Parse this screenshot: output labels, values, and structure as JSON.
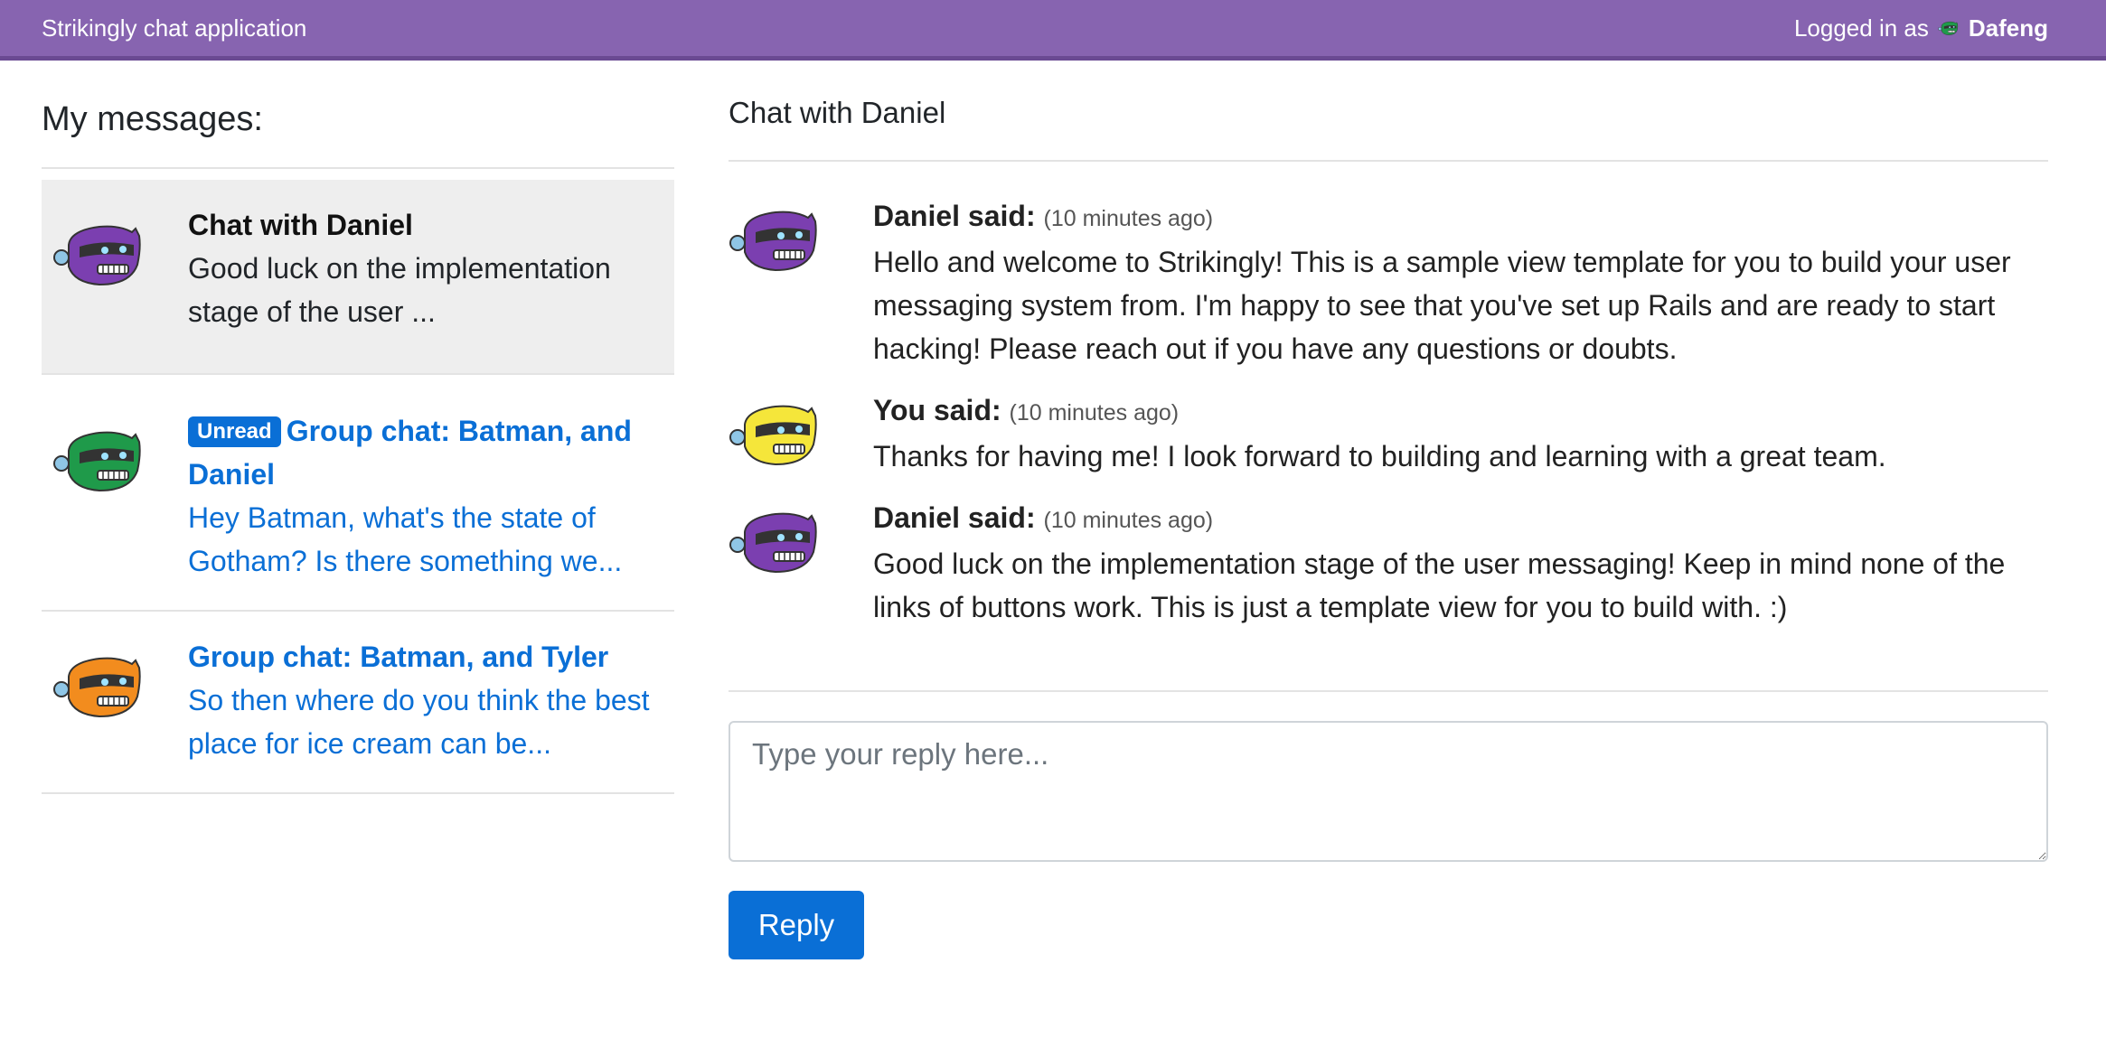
{
  "topbar": {
    "brand": "Strikingly chat application",
    "logged_in_prefix": "Logged in as",
    "username": "Dafeng",
    "bar_color": "#8764b0"
  },
  "sidebar": {
    "heading": "My messages:",
    "conversations": [
      {
        "title": "Chat with Daniel",
        "snippet": "Good luck on the implementation stage of the user ...",
        "unread": false,
        "active": true,
        "avatar": "purple-robot-icon"
      },
      {
        "badge": "Unread",
        "title": "Group chat: Batman, and Daniel",
        "snippet": "Hey Batman, what's the state of Gotham? Is there something we...",
        "unread": true,
        "active": false,
        "avatar": "green-robot-icon"
      },
      {
        "title": "Group chat: Batman, and Tyler",
        "snippet": "So then where do you think the best place for ice cream can be...",
        "unread": false,
        "active": false,
        "avatar": "orange-robot-icon"
      }
    ]
  },
  "chat": {
    "title": "Chat with Daniel",
    "messages": [
      {
        "who": "Daniel said:",
        "when": "(10 minutes ago)",
        "text": "Hello and welcome to Strikingly! This is a sample view template for you to build your user messaging system from. I'm happy to see that you've set up Rails and are ready to start hacking! Please reach out if you have any questions or doubts.",
        "avatar": "purple-robot-icon"
      },
      {
        "who": "You said:",
        "when": "(10 minutes ago)",
        "text": "Thanks for having me! I look forward to building and learning with a great team.",
        "avatar": "yellow-robot-icon"
      },
      {
        "who": "Daniel said:",
        "when": "(10 minutes ago)",
        "text": "Good luck on the implementation stage of the user messaging! Keep in mind none of the links of buttons work. This is just a template view for you to build with. :)",
        "avatar": "purple-robot-icon"
      }
    ],
    "reply_placeholder": "Type your reply here...",
    "reply_button": "Reply"
  },
  "colors": {
    "accent": "#0a6fd6",
    "active_bg": "#eeeeee",
    "purple_robot": "#7b3fb0",
    "green_robot": "#1f9a4a",
    "orange_robot": "#f28c1e",
    "yellow_robot": "#f5e63a"
  }
}
